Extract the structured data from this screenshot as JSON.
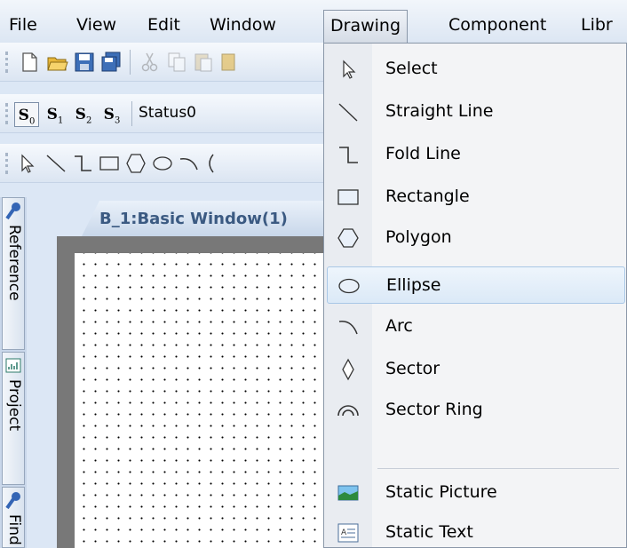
{
  "menubar": {
    "items": [
      "File",
      "View",
      "Edit",
      "Window",
      "Drawing",
      "Component",
      "Libr"
    ]
  },
  "toolbar_status": {
    "buttons": [
      {
        "letter": "S",
        "index": "0"
      },
      {
        "letter": "S",
        "index": "1"
      },
      {
        "letter": "S",
        "index": "2"
      },
      {
        "letter": "S",
        "index": "3"
      }
    ],
    "combo_value": "Status0"
  },
  "sidetabs": [
    "Reference",
    "Project",
    "Find"
  ],
  "document": {
    "tab_label": "B_1:Basic Window(1)"
  },
  "drawing_menu": {
    "items": [
      {
        "label": "Select",
        "icon": "select-arrow-icon"
      },
      {
        "label": "Straight Line",
        "icon": "straight-line-icon"
      },
      {
        "label": "Fold Line",
        "icon": "fold-line-icon"
      },
      {
        "label": "Rectangle",
        "icon": "rectangle-icon"
      },
      {
        "label": "Polygon",
        "icon": "polygon-icon"
      },
      {
        "label": "Ellipse",
        "icon": "ellipse-icon"
      },
      {
        "label": "Arc",
        "icon": "arc-icon"
      },
      {
        "label": "Sector",
        "icon": "sector-icon"
      },
      {
        "label": "Sector Ring",
        "icon": "sector-ring-icon"
      },
      {
        "label": "Static Picture",
        "icon": "picture-icon"
      },
      {
        "label": "Static Text",
        "icon": "text-icon"
      }
    ],
    "highlighted": "Ellipse"
  },
  "colors": {
    "menu_highlight": "#dbe9f7",
    "doc_tab_text": "#3b5a82",
    "canvas_frame": "#787878"
  }
}
